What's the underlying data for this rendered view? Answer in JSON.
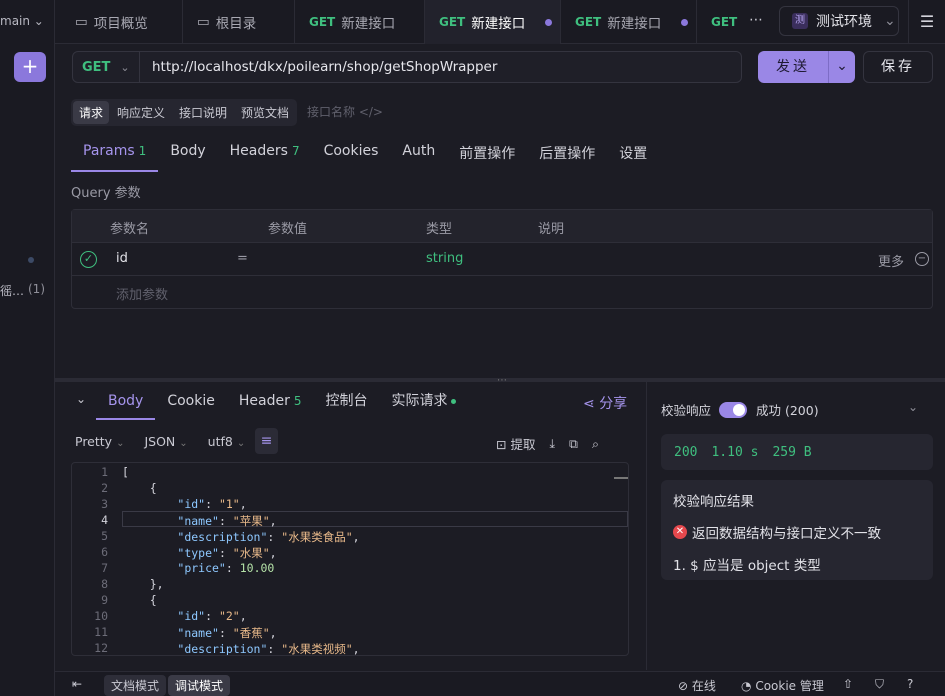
{
  "sidebar": {
    "branch": "main",
    "plus": "+",
    "truncated_item": "徭…",
    "count": "(1)"
  },
  "tabs": [
    {
      "label": "项目概览",
      "icon": "▭"
    },
    {
      "label": "根目录",
      "icon": "▭"
    },
    {
      "method": "GET",
      "label": "新建接口"
    },
    {
      "method": "GET",
      "label": "新建接口"
    },
    {
      "method": "GET",
      "label": "新建接口"
    },
    {
      "method": "GET",
      "label": ""
    }
  ],
  "tab_more": "⋯",
  "env": {
    "badge": "测",
    "label": "测试环境",
    "chevron": "⌄"
  },
  "menu_icon": "☰",
  "request": {
    "method": "GET",
    "url": "http://localhost/dkx/poilearn/shop/getShopWrapper",
    "send": "发送",
    "save": "保存"
  },
  "subtabs": [
    "请求",
    "响应定义",
    "接口说明",
    "预览文档"
  ],
  "iface_name_placeholder": "接口名称 </>",
  "param_tabs": [
    {
      "label": "Params",
      "count": "1"
    },
    {
      "label": "Body",
      "count": ""
    },
    {
      "label": "Headers",
      "count": "7"
    },
    {
      "label": "Cookies",
      "count": ""
    },
    {
      "label": "Auth",
      "count": ""
    },
    {
      "label": "前置操作",
      "count": ""
    },
    {
      "label": "后置操作",
      "count": ""
    },
    {
      "label": "设置",
      "count": ""
    }
  ],
  "query": {
    "label": "Query 参数",
    "headers": {
      "name": "参数名",
      "value": "参数值",
      "type": "类型",
      "desc": "说明"
    },
    "row": {
      "name": "id",
      "eq": "=",
      "type": "string",
      "more": "更多"
    },
    "add": "添加参数"
  },
  "response": {
    "tabs": [
      {
        "label": "Body",
        "count": ""
      },
      {
        "label": "Cookie",
        "count": ""
      },
      {
        "label": "Header",
        "count": "5"
      },
      {
        "label": "控制台",
        "count": ""
      },
      {
        "label": "实际请求",
        "count": ""
      }
    ],
    "share": "分享",
    "format": [
      "Pretty",
      "JSON",
      "utf8"
    ],
    "extract": "提取",
    "code_lines": [
      "[",
      "    {",
      "        \"id\": \"1\",",
      "        \"name\": \"苹果\",",
      "        \"description\": \"水果类食品\",",
      "        \"type\": \"水果\",",
      "        \"price\": 10.00",
      "    },",
      "    {",
      "        \"id\": \"2\",",
      "        \"name\": \"香蕉\",",
      "        \"description\": \"水果类视频\","
    ]
  },
  "verify": {
    "label": "校验响应",
    "status": "成功 (200)",
    "code": "200",
    "time": "1.10 s",
    "size": "259 B",
    "result_title": "校验响应结果",
    "error": "返回数据结构与接口定义不一致",
    "detail": "1. $ 应当是 object 类型"
  },
  "bottom": {
    "doc_mode": "文档模式",
    "debug_mode": "调试模式",
    "online": "在线",
    "cookie": "Cookie 管理"
  },
  "colors": {
    "accent": "#9a87e6",
    "get_green": "#3fbf7f",
    "error_red": "#e5484d"
  }
}
